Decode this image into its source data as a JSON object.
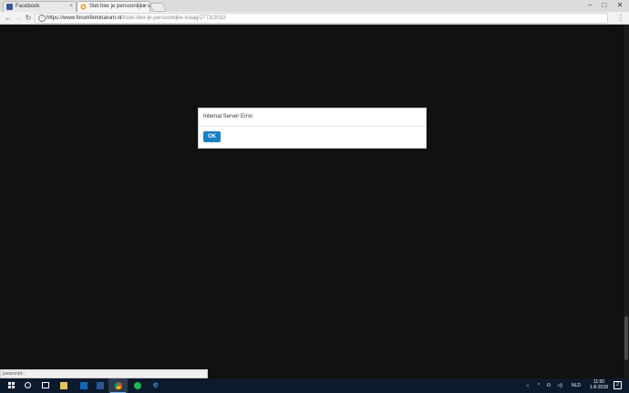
{
  "browser": {
    "tabs": [
      {
        "title": "Facebook",
        "close": "×"
      },
      {
        "title": "Stel hier je persoonlijke v",
        "close": "×"
      }
    ],
    "window_controls": {
      "minimize": "–",
      "maximize": "□",
      "close": "✕"
    },
    "nav": {
      "back": "←",
      "forward": "→",
      "reload": "↻"
    },
    "url_host": "https://www.forumfeminarum.nl",
    "url_path": "/t/stel-hier-je-persoonlijke-vraag/2773/2032",
    "info_glyph": "i",
    "star_glyph": "☆",
    "menu_glyph": "⋮"
  },
  "dialog": {
    "message": "Internal Server Error",
    "ok_label": "OK"
  },
  "status_bar": "javascript:;",
  "taskbar": {
    "tray_glyphs": {
      "network_name": "⌂",
      "chevron": "^",
      "wifi": "☊",
      "volume": "◁)",
      "lang": "NLD"
    },
    "time": "11:50",
    "date": "1-8-2018",
    "notifications_count": "2"
  }
}
